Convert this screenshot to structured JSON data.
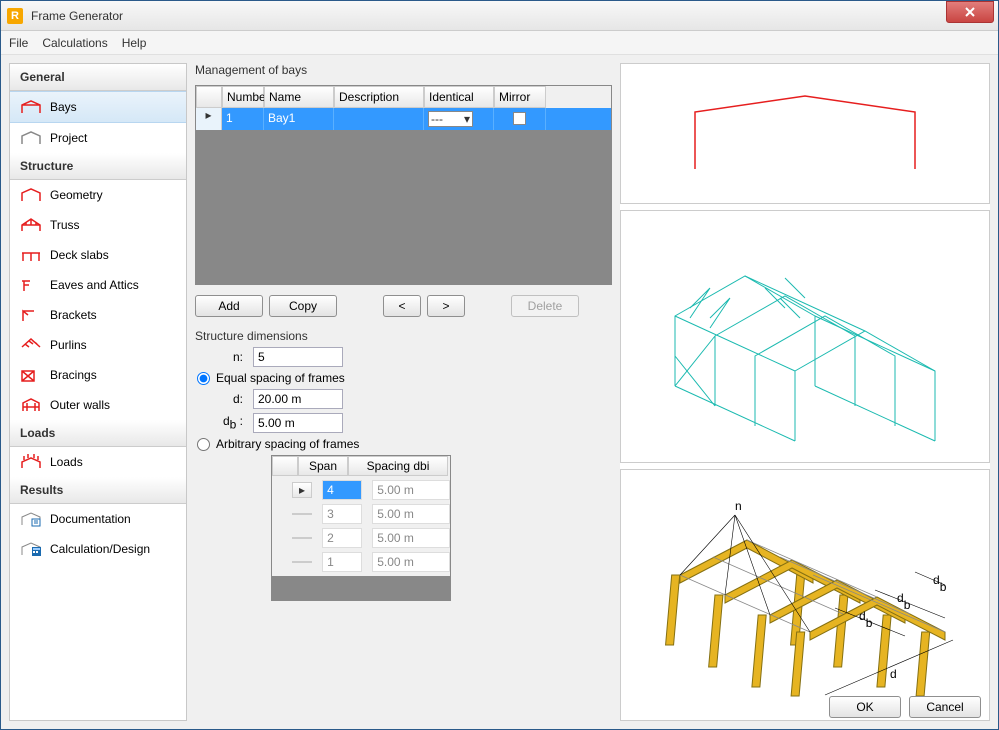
{
  "window": {
    "title": "Frame Generator"
  },
  "menu": {
    "file": "File",
    "calc": "Calculations",
    "help": "Help"
  },
  "sidebar": {
    "general": {
      "header": "General",
      "bays": "Bays",
      "project": "Project"
    },
    "structure": {
      "header": "Structure",
      "geometry": "Geometry",
      "truss": "Truss",
      "deckslabs": "Deck slabs",
      "eaves": "Eaves and Attics",
      "brackets": "Brackets",
      "purlins": "Purlins",
      "bracings": "Bracings",
      "outerwalls": "Outer walls"
    },
    "loads": {
      "header": "Loads",
      "loads": "Loads"
    },
    "results": {
      "header": "Results",
      "doc": "Documentation",
      "calcdesign": "Calculation/Design"
    }
  },
  "bays": {
    "title": "Management of bays",
    "cols": {
      "number": "Numbe",
      "name": "Name",
      "desc": "Description",
      "identical": "Identical",
      "mirror": "Mirror"
    },
    "row": {
      "num": "1",
      "name": "Bay1",
      "desc": "",
      "identical": "---"
    },
    "buttons": {
      "add": "Add",
      "copy": "Copy",
      "prev": "<",
      "next": ">",
      "delete": "Delete"
    }
  },
  "dims": {
    "title": "Structure dimensions",
    "n_label": "n:",
    "n_value": "5",
    "equal_label": "Equal spacing of frames",
    "d_label": "d:",
    "d_value": "20.00 m",
    "db_html": "d<sub>b</sub> :",
    "db_value": "5.00 m",
    "arbitrary_label": "Arbitrary spacing of frames"
  },
  "spans": {
    "cols": {
      "span": "Span",
      "spacing": "Spacing dbi"
    },
    "rows": [
      {
        "span": "4",
        "spacing": "5.00 m",
        "sel": true
      },
      {
        "span": "3",
        "spacing": "5.00 m"
      },
      {
        "span": "2",
        "spacing": "5.00 m"
      },
      {
        "span": "1",
        "spacing": "5.00 m"
      }
    ]
  },
  "preview": {
    "labels": {
      "n": "n",
      "d": "d",
      "db": "d_b"
    }
  },
  "footer": {
    "ok": "OK",
    "cancel": "Cancel"
  }
}
